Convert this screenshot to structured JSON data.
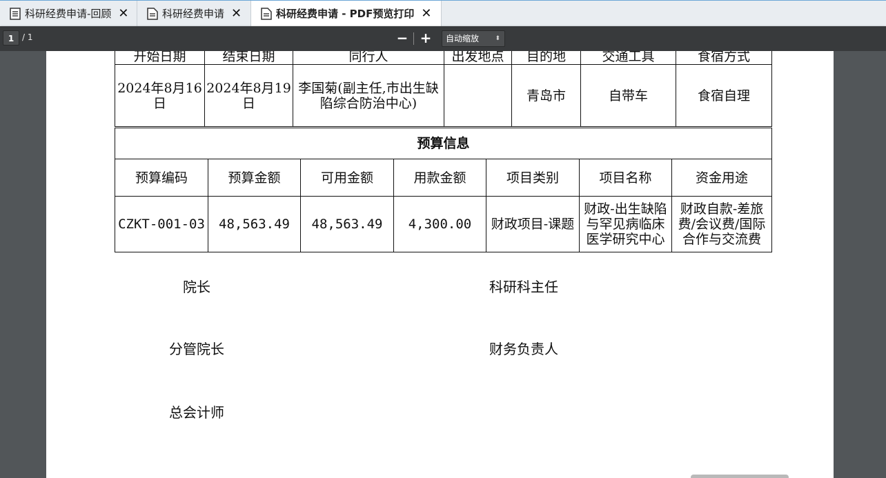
{
  "tabs": [
    {
      "label": "科研经费申请-回顾",
      "active": false
    },
    {
      "label": "科研经费申请",
      "active": false
    },
    {
      "label": "科研经费申请 - PDF预览打印",
      "active": true
    }
  ],
  "toolbar": {
    "page_current": "1",
    "page_total": "/ 1",
    "zoom_out": "−",
    "zoom_in": "+",
    "zoom_value": "自动缩放",
    "zoom_arrow": "⬍"
  },
  "trip_table": {
    "header_partial": [
      "开始日期",
      "结束日期",
      "同行人",
      "出发地点",
      "目的地",
      "交通工具",
      "食宿方式"
    ],
    "row": {
      "start": "2024年8月16日",
      "end": "2024年8月19日",
      "companion": "李国菊(副主任,市出生缺陷综合防治中心)",
      "origin": "",
      "destination": "青岛市",
      "transport": "自带车",
      "lodging": "食宿自理"
    }
  },
  "budget": {
    "title": "预算信息",
    "headers": [
      "预算编码",
      "预算金额",
      "可用金额",
      "用款金额",
      "项目类别",
      "项目名称",
      "资金用途"
    ],
    "row": {
      "code": "CZKT-001-03",
      "budget_amount": "48,563.49",
      "available_amount": "48,563.49",
      "used_amount": "4,300.00",
      "category": "财政项目-课题",
      "project_name": "财政-出生缺陷与罕见病临床医学研究中心",
      "purpose": "财政自款-差旅费/会议费/国际合作与交流费"
    }
  },
  "signatures": {
    "dean": "院长",
    "research_director": "科研科主任",
    "vice_dean": "分管院长",
    "finance_head": "财务负责人",
    "chief_accountant": "总会计师"
  }
}
